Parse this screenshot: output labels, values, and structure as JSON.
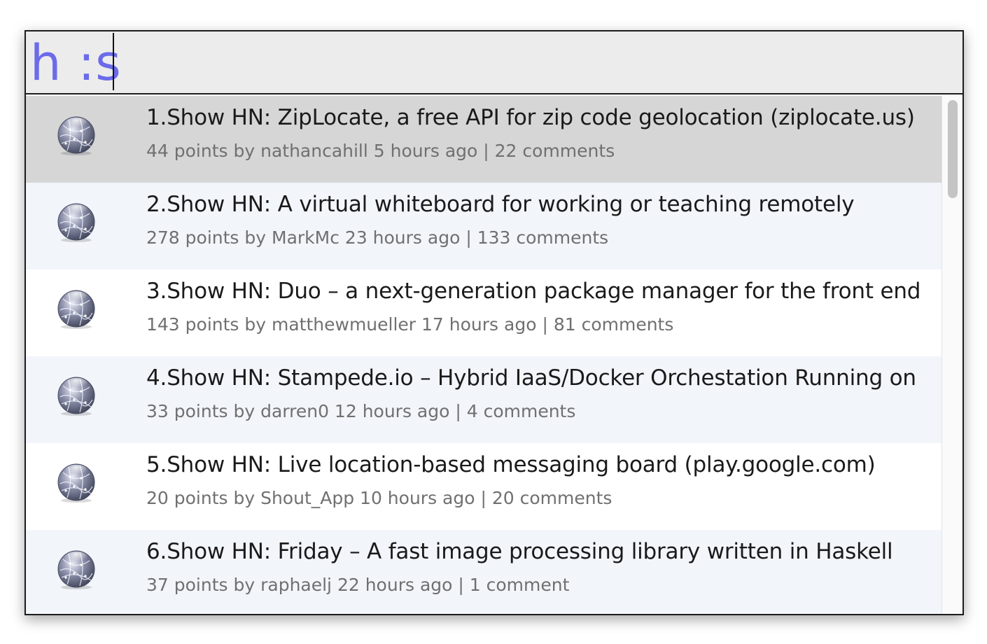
{
  "search": {
    "query": "h :s"
  },
  "results": [
    {
      "index": "1.",
      "title": "Show HN: ZipLocate, a free API for zip code geolocation (ziplocate.us)",
      "meta": "44 points by nathancahill 5 hours ago | 22 comments",
      "icon": "globe-icon",
      "selected": true
    },
    {
      "index": "2.",
      "title": "Show HN: A virtual whiteboard for working or teaching remotely",
      "meta": "278 points by MarkMc 23 hours ago | 133 comments",
      "icon": "globe-icon",
      "selected": false
    },
    {
      "index": "3.",
      "title": "Show HN: Duo – a next-generation package manager for the front end",
      "meta": "143 points by matthewmueller 17 hours ago | 81 comments",
      "icon": "globe-icon",
      "selected": false
    },
    {
      "index": "4.",
      "title": "Show HN: Stampede.io – Hybrid IaaS/Docker Orchestation Running on",
      "meta": "33 points by darren0 12 hours ago | 4 comments",
      "icon": "globe-icon",
      "selected": false
    },
    {
      "index": "5.",
      "title": "Show HN: Live location-based messaging board (play.google.com)",
      "meta": "20 points by Shout_App 10 hours ago | 20 comments",
      "icon": "globe-icon",
      "selected": false
    },
    {
      "index": "6.",
      "title": "Show HN: Friday – A fast image processing library written in Haskell",
      "meta": "37 points by raphaelj 22 hours ago | 1 comment",
      "icon": "globe-icon",
      "selected": false
    }
  ],
  "colors": {
    "query_text": "#6b6bea",
    "selected_row": "#d6d6d6",
    "alt_row": "#f2f5fa"
  }
}
